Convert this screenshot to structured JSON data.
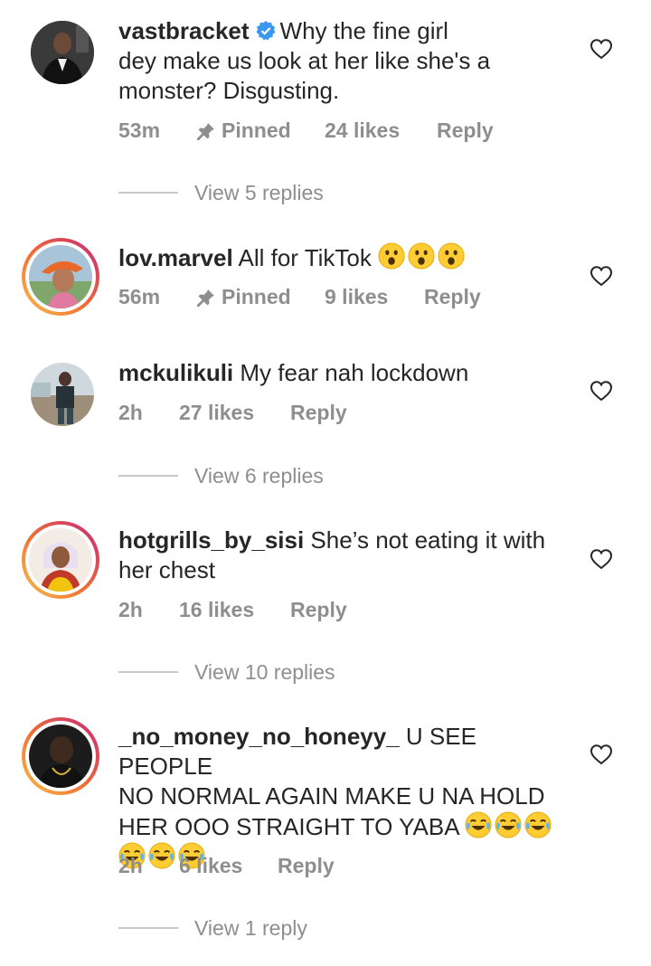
{
  "comments": [
    {
      "username": "vastbracket",
      "verified": true,
      "text_lines": [
        "Why the fine girl",
        "dey make us look at her like she's a",
        "monster? Disgusting."
      ],
      "time": "53m",
      "pinned": "Pinned",
      "likes": "24 likes",
      "reply": "Reply",
      "view_replies": "View 5 replies"
    },
    {
      "username": "lov.marvel",
      "text": "All for TikTok",
      "emoji": [
        "surprised-face-emoji",
        "surprised-face-emoji",
        "surprised-face-emoji"
      ],
      "time": "56m",
      "pinned": "Pinned",
      "likes": "9 likes",
      "reply": "Reply"
    },
    {
      "username": "mckulikuli",
      "text": "My fear nah lockdown",
      "time": "2h",
      "likes": "27 likes",
      "reply": "Reply",
      "view_replies": "View 6 replies"
    },
    {
      "username": "hotgrills_by_sisi",
      "text_line1": "She’s not eating it with",
      "text_line2": "her chest",
      "time": "2h",
      "likes": "16 likes",
      "reply": "Reply",
      "view_replies": "View 10 replies"
    },
    {
      "username": "_no_money_no_honeyy_",
      "text_line1": "U SEE PEOPLE",
      "text_line2": "NO NORMAL AGAIN MAKE U NA HOLD",
      "text_line3": "HER OOO STRAIGHT TO YABA",
      "emoji": [
        "tears-of-joy-emoji",
        "tears-of-joy-emoji",
        "tears-of-joy-emoji",
        "tears-of-joy-emoji",
        "tears-of-joy-emoji",
        "tears-of-joy-emoji"
      ],
      "time": "2h",
      "likes": "6 likes",
      "reply": "Reply",
      "view_replies": "View 1 reply"
    }
  ],
  "colors": {
    "text": "#262626",
    "meta": "#8e8e8e",
    "verified": "#3897f0",
    "story_ring_start": "#f9c04c",
    "story_ring_end": "#c4287a"
  }
}
